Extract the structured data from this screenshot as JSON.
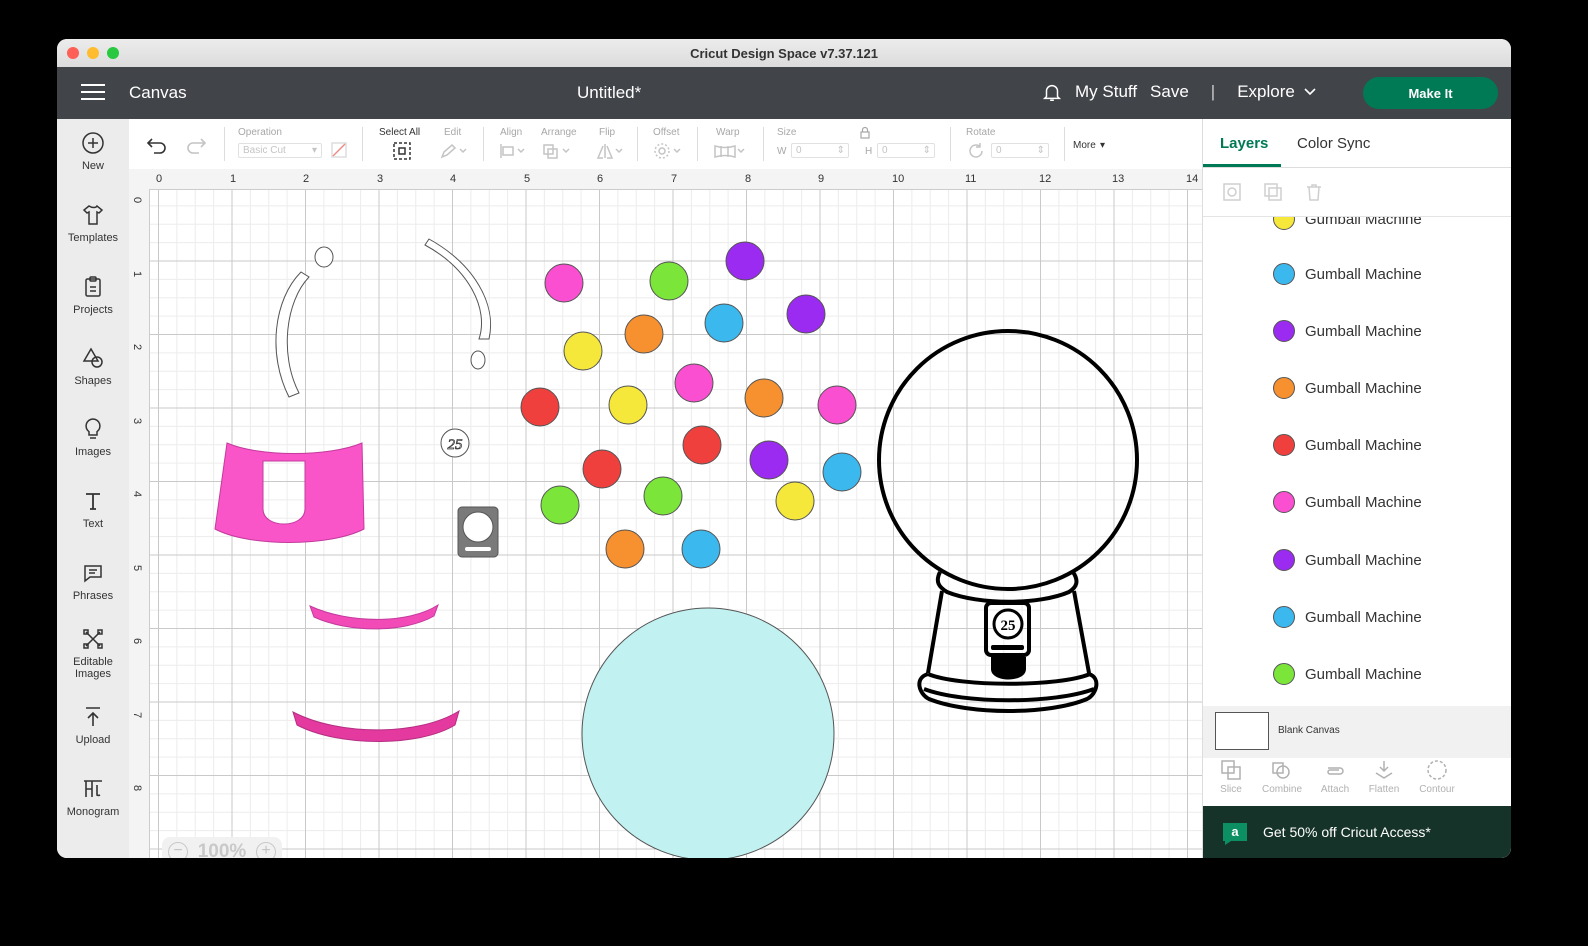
{
  "window": {
    "title": "Cricut Design Space  v7.37.121"
  },
  "appbar": {
    "canvas_label": "Canvas",
    "document_title": "Untitled*",
    "my_stuff": "My Stuff",
    "save": "Save",
    "separator": "|",
    "explore": "Explore",
    "make_it": "Make It"
  },
  "leftbar": {
    "items": [
      {
        "label": "New",
        "icon": "plus-circle-icon"
      },
      {
        "label": "Templates",
        "icon": "tshirt-icon"
      },
      {
        "label": "Projects",
        "icon": "clipboard-icon"
      },
      {
        "label": "Shapes",
        "icon": "shapes-icon"
      },
      {
        "label": "Images",
        "icon": "lightbulb-icon"
      },
      {
        "label": "Text",
        "icon": "text-icon"
      },
      {
        "label": "Phrases",
        "icon": "speech-bubble-icon"
      },
      {
        "label": "Editable Images",
        "icon": "editable-image-icon"
      },
      {
        "label": "Upload",
        "icon": "upload-icon"
      },
      {
        "label": "Monogram",
        "icon": "monogram-icon"
      }
    ]
  },
  "toolbar": {
    "operation_label": "Operation",
    "operation_value": "Basic Cut",
    "select_all": "Select All",
    "edit": "Edit",
    "align": "Align",
    "arrange": "Arrange",
    "flip": "Flip",
    "offset": "Offset",
    "warp": "Warp",
    "size": "Size",
    "w_label": "W",
    "h_label": "H",
    "w_value": "0",
    "h_value": "0",
    "rotate": "Rotate",
    "rotate_value": "0",
    "more": "More"
  },
  "canvas": {
    "ruler_top": [
      "0",
      "1",
      "2",
      "3",
      "4",
      "5",
      "6",
      "7",
      "8",
      "9",
      "10",
      "11",
      "12",
      "13",
      "14"
    ],
    "ruler_left": [
      "0",
      "1",
      "2",
      "3",
      "4",
      "5",
      "6",
      "7",
      "8"
    ],
    "zoom": "100%",
    "coin_label": "25"
  },
  "rightpanel": {
    "tabs": [
      "Layers",
      "Color Sync"
    ],
    "layers": [
      {
        "name": "Gumball Machine",
        "color": "#f5e83a"
      },
      {
        "name": "Gumball Machine",
        "color": "#3bb8ee"
      },
      {
        "name": "Gumball Machine",
        "color": "#9b2bf0"
      },
      {
        "name": "Gumball Machine",
        "color": "#f7902e"
      },
      {
        "name": "Gumball Machine",
        "color": "#f0403e"
      },
      {
        "name": "Gumball Machine",
        "color": "#fb4fd1"
      },
      {
        "name": "Gumball Machine",
        "color": "#9b2bf0"
      },
      {
        "name": "Gumball Machine",
        "color": "#3bb8ee"
      },
      {
        "name": "Gumball Machine",
        "color": "#7be53a"
      }
    ],
    "blank_canvas": "Blank Canvas",
    "actions": [
      "Slice",
      "Combine",
      "Attach",
      "Flatten",
      "Contour"
    ],
    "promo": "Get 50% off Cricut Access*"
  },
  "colors": {
    "appbar": "#414449",
    "accent_green": "#007a55",
    "gumball_pink": "#fb4fd1",
    "gumball_green": "#7be53a",
    "gumball_purple": "#9b2bf0",
    "gumball_blue": "#3bb8ee",
    "gumball_yellow": "#f5e83a",
    "gumball_orange": "#f7902e",
    "gumball_red": "#f0403e",
    "base_pink": "#f955c8",
    "globe_fill": "#c2f1f1"
  }
}
